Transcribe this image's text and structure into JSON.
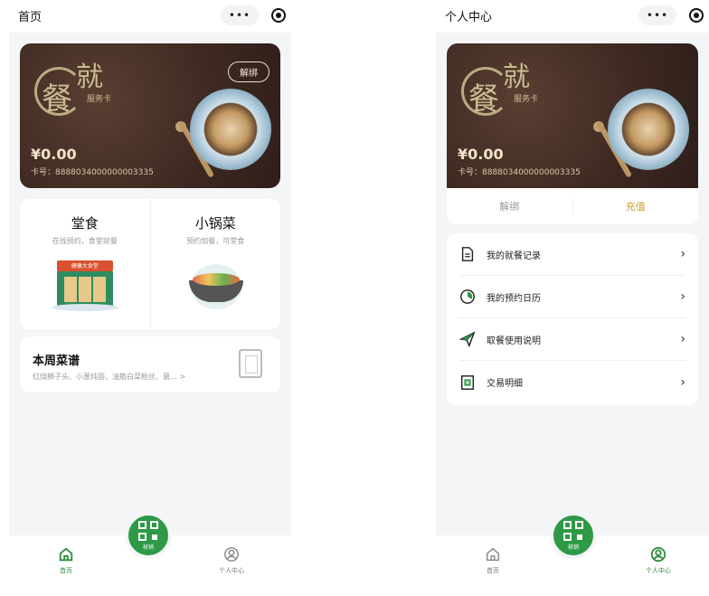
{
  "colors": {
    "accent": "#2e9a46",
    "recharge": "#d79b2a",
    "card_bg": "#3f2a22"
  },
  "home": {
    "title": "首页",
    "card": {
      "logo_big1": "餐",
      "logo_big2": "就",
      "logo_sub": "服务卡",
      "unbind": "解绑",
      "balance": "¥0.00",
      "card_no": "卡号：8888034000000003335"
    },
    "dine": {
      "title": "堂食",
      "subtitle": "在线预约，食堂就餐",
      "shop_sign": "健康大食堂"
    },
    "pot": {
      "title": "小锅菜",
      "subtitle": "预约加餐，可堂食"
    },
    "weekly": {
      "title": "本周菜谱",
      "items": "红烧狮子头、小葱炖面、油筋白菜粉丝、菌… >"
    },
    "tabs": {
      "home": "首页",
      "scan": "核销",
      "me": "个人中心"
    }
  },
  "profile": {
    "title": "个人中心",
    "card": {
      "logo_big1": "餐",
      "logo_big2": "就",
      "logo_sub": "服务卡",
      "balance": "¥0.00",
      "card_no": "卡号：8888034000000003335"
    },
    "actions": {
      "unbind": "解绑",
      "recharge": "充值"
    },
    "list": [
      {
        "label": "我的就餐记录",
        "icon": "document-icon"
      },
      {
        "label": "我的预约日历",
        "icon": "clock-icon"
      },
      {
        "label": "取餐使用说明",
        "icon": "send-icon"
      },
      {
        "label": "交易明细",
        "icon": "receipt-icon"
      }
    ],
    "tabs": {
      "home": "首页",
      "scan": "核销",
      "me": "个人中心"
    }
  },
  "capsule": {
    "dots": "•••"
  }
}
